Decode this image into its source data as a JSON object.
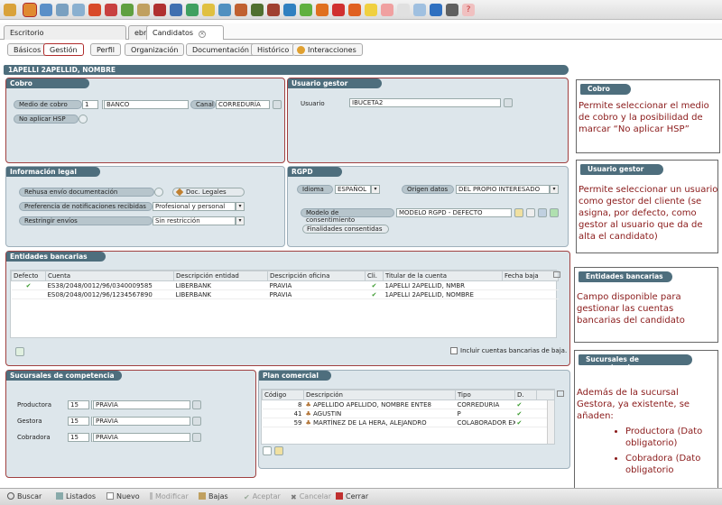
{
  "window_tabs": [
    {
      "label": "Escritorio"
    },
    {
      "label": "ebroker TV"
    },
    {
      "label": "Candidatos"
    }
  ],
  "sub_tabs": [
    "Básicos",
    "Gestión",
    "Perfil",
    "Organización",
    "Documentación",
    "Histórico",
    "Interacciones"
  ],
  "record_title": "1APELLI 2APELLID, NOMBRE",
  "cobro": {
    "title": "Cobro",
    "medio_label": "Medio de cobro",
    "medio_code": "1",
    "medio_value": "BANCO",
    "canal_label": "Canal",
    "canal_value": "CORREDURÍA",
    "no_hsp_label": "No aplicar HSP"
  },
  "usuario_gestor": {
    "title": "Usuario gestor",
    "usuario_label": "Usuario",
    "usuario_value": "IBUCETA2"
  },
  "info_legal": {
    "title": "Información legal",
    "rehusa_label": "Rehusa envío documentación",
    "doc_legales": "Doc. Legales",
    "pref_label": "Preferencia de notificaciones recibidas",
    "pref_value": "Profesional y personal",
    "restringir_label": "Restringir envíos",
    "restringir_value": "Sin restricción"
  },
  "rgpd": {
    "title": "RGPD",
    "idioma_label": "Idioma",
    "idioma_value": "ESPAÑOL",
    "origen_label": "Origen datos",
    "origen_value": "DEL PROPIO INTERESADO",
    "modelo_label": "Modelo de consentimiento",
    "modelo_value": "MODELO RGPD - DEFECTO",
    "finalidades": "Finalidades consentidas"
  },
  "entidades": {
    "title": "Entidades bancarias",
    "columns": [
      "Defecto",
      "Cuenta",
      "Descripción entidad",
      "Descripción oficina",
      "Cli.",
      "Titular de la cuenta",
      "Fecha baja"
    ],
    "rows": [
      {
        "defecto": "✔",
        "cuenta": "ES38/2048/0012/96/0340009585",
        "entidad": "LIBERBANK",
        "oficina": "PRAVIA",
        "cli": "✔",
        "titular": "1APELLI 2APELLID, NMBR",
        "baja": ""
      },
      {
        "defecto": "",
        "cuenta": "ES08/2048/0012/96/1234567890",
        "entidad": "LIBERBANK",
        "oficina": "PRAVIA",
        "cli": "✔",
        "titular": "1APELLI 2APELLID, NOMBRE",
        "baja": ""
      }
    ],
    "incluir_baja": "Incluir cuentas bancarias de baja."
  },
  "sucursales": {
    "title": "Sucursales de competencia",
    "rows": [
      {
        "label": "Productora",
        "code": "15",
        "value": "PRAVIA"
      },
      {
        "label": "Gestora",
        "code": "15",
        "value": "PRAVIA"
      },
      {
        "label": "Cobradora",
        "code": "15",
        "value": "PRAVIA"
      }
    ]
  },
  "plan": {
    "title": "Plan comercial",
    "columns": [
      "Código",
      "Descripción",
      "Tipo",
      "D."
    ],
    "rows": [
      {
        "codigo": "8",
        "desc": "APELLIDO APELLIDO, NOMBRE ENTE8",
        "tipo": "CORREDURIA",
        "d": "✔"
      },
      {
        "codigo": "41",
        "desc": "AGUSTIN",
        "tipo": "P",
        "d": "✔"
      },
      {
        "codigo": "59",
        "desc": "MARTÍNEZ DE LA HERA, ALEJANDRO",
        "tipo": "COLABORADOR EX",
        "d": "✔"
      }
    ]
  },
  "notes": {
    "cobro": {
      "title": "Cobro",
      "text": "Permite seleccionar el medio de cobro y la posibilidad de marcar “No aplicar HSP”"
    },
    "usuario": {
      "title": "Usuario gestor",
      "text": "Permite seleccionar un usuario como gestor del cliente (se asigna, por defecto, como gestor al usuario que da de alta el candidato)"
    },
    "entidades": {
      "title": "Entidades bancarias",
      "text": "Campo disponible para gestionar las cuentas bancarias del candidato"
    },
    "sucursales": {
      "title": "Sucursales de competencia",
      "text": "Además de la sucursal Gestora, ya existente, se añaden:",
      "items": [
        "Productora (Dato obligatorio)",
        "Cobradora (Dato obligatorio"
      ]
    }
  },
  "bottom_bar": [
    {
      "label": "Buscar",
      "enabled": true
    },
    {
      "label": "Listados",
      "enabled": true
    },
    {
      "label": "Nuevo",
      "enabled": true
    },
    {
      "label": "Modificar",
      "enabled": false
    },
    {
      "label": "Bajas",
      "enabled": true
    },
    {
      "label": "Aceptar",
      "enabled": false
    },
    {
      "label": "Cancelar",
      "enabled": false
    },
    {
      "label": "Cerrar",
      "enabled": true
    }
  ]
}
